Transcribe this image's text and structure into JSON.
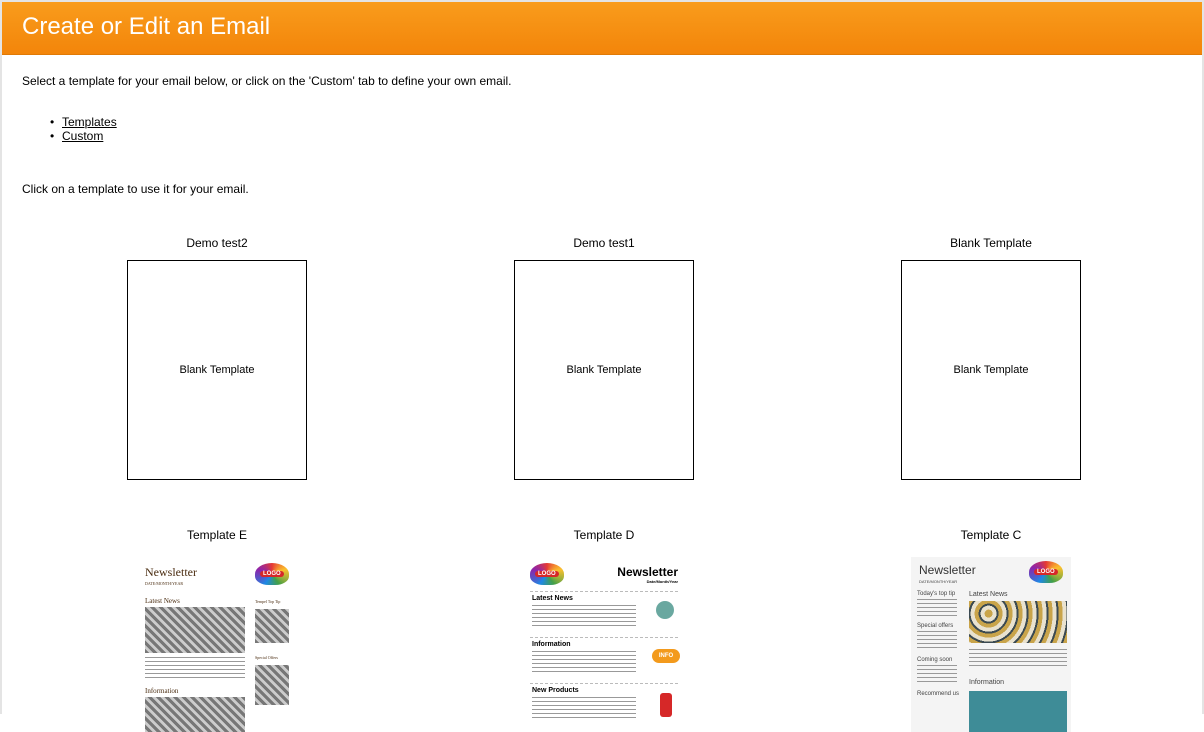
{
  "header": {
    "title": "Create or Edit an Email"
  },
  "intro": "Select a template for your email below, or click on the 'Custom' tab to define your own email.",
  "tabs": [
    {
      "label": "Templates"
    },
    {
      "label": "Custom"
    }
  ],
  "hint": "Click on a template to use it for your email.",
  "templates": [
    {
      "name": "Demo test2",
      "preview_text": "Blank Template"
    },
    {
      "name": "Demo test1",
      "preview_text": "Blank Template"
    },
    {
      "name": "Blank Template",
      "preview_text": "Blank Template"
    },
    {
      "name": "Template E",
      "preview": {
        "title": "Newsletter",
        "subtitle": "DATE/MONTH/YEAR",
        "logo": "LOGO",
        "sections": [
          "Latest News",
          "Information"
        ],
        "side_sections": [
          "Tempel Top Tip",
          "Special Offers"
        ]
      }
    },
    {
      "name": "Template D",
      "preview": {
        "title": "Newsletter",
        "subtitle": "Date/Month/Year",
        "logo": "LOGO",
        "sections": [
          "Latest News",
          "Information",
          "New Products"
        ],
        "badge": "INFO"
      }
    },
    {
      "name": "Template C",
      "preview": {
        "title": "Newsletter",
        "subtitle": "DATE/MONTH/YEAR",
        "logo": "LOGO",
        "sections": [
          "Latest News",
          "Information"
        ],
        "side_sections": [
          "Today's top tip",
          "Special offers",
          "Coming soon",
          "Recommend us"
        ]
      }
    }
  ],
  "colors": {
    "header": "#f3850a",
    "template_e_frame": "#7a4a1c",
    "template_d_frame": "#b2140c",
    "template_c_frame": "#5b6068"
  }
}
